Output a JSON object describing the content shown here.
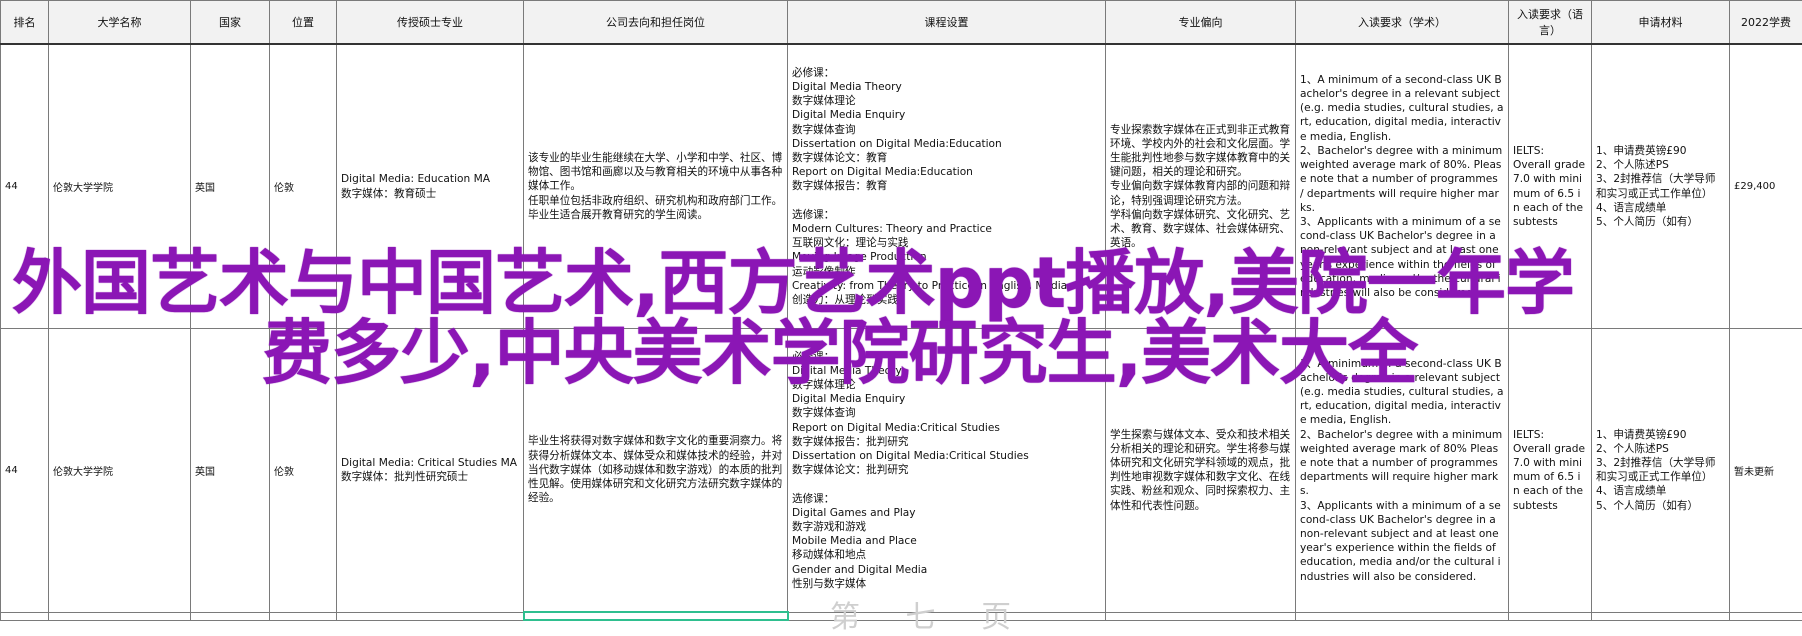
{
  "table": {
    "headers": [
      "排名",
      "大学名称",
      "国家",
      "位置",
      "传授硕士专业",
      "公司去向和担任岗位",
      "课程设置",
      "专业偏向",
      "入读要求（学术）",
      "入读要求（语言）",
      "申请材料",
      "2022学费"
    ],
    "rows": [
      {
        "rank": "44",
        "university": "伦敦大学学院",
        "country": "英国",
        "location": "伦敦",
        "program": "Digital Media: Education MA\n数字媒体：教育硕士",
        "careers": "该专业的毕业生能继续在大学、小学和中学、社区、博物馆、图书馆和画廊以及与教育相关的环境中从事各种媒体工作。\n任职单位包括非政府组织、研究机构和政府部门工作。毕业生适合展开教育研究的学生阅读。",
        "courses": "必修课：\nDigital Media Theory\n数字媒体理论\nDigital Media Enquiry\n数字媒体查询\nDissertation on Digital Media:Education\n数字媒体论文：教育\nReport on Digital Media:Education\n数字媒体报告：教育\n\n选修课：\nModern Cultures: Theory and Practice\n互联网文化：理论与实践\nMoving Image Production\n运动影像制作\nCreativity: from Theory to Practice in English, Media\n创造力：从理论到实践",
        "focus": "专业探索数字媒体在正式到非正式教育环境、学校内外的社会和文化层面。学生能批判性地参与数字媒体教育中的关键问题，相关的理论和研究。\n专业偏向数字媒体教育内部的问题和辩论，特别强调理论研究方法。\n学科偏向数字媒体研究、文化研究、艺术、教育、数字媒体、社会媒体研究、英语。",
        "academic": "1、A minimum of a second-class UK Bachelor's degree in a relevant subject (e.g. media studies, cultural studies, art, education, digital media, interactive media, English.\n2、Bachelor's degree with a minimum weighted average mark of 80%. Please note that a number of programmes / departments will require higher marks.\n3、Applicants with a minimum of a second-class UK Bachelor's degree in a non-relevant subject and at least one year's experience within the fields of education, media and/or the cultural industries will also be considered.",
        "language": "IELTS:\nOverall grade 7.0 with minimum of 6.5 in each of the subtests",
        "materials": "1、申请费英镑£90\n2、个人陈述PS\n3、2封推荐信（大学导师和实习或正式工作单位）\n4、语言成绩单\n5、个人简历（如有）",
        "fee": "£29,400"
      },
      {
        "rank": "44",
        "university": "伦敦大学学院",
        "country": "英国",
        "location": "伦敦",
        "program": "Digital Media: Critical Studies MA\n数字媒体：批判性研究硕士",
        "careers": "毕业生将获得对数字媒体和数字文化的重要洞察力。将获得分析媒体文本、媒体受众和媒体技术的经验，并对当代数字媒体（如移动媒体和数字游戏）的本质的批判性见解。使用媒体研究和文化研究方法研究数字媒体的经验。",
        "courses": "必修课：\nDigital Media Theory\n数字媒体理论\nDigital Media Enquiry\n数字媒体查询\nReport on Digital Media:Critical Studies\n数字媒体报告：批判研究\nDissertation on Digital Media:Critical Studies\n数字媒体论文：批判研究\n\n选修课：\nDigital Games and Play\n数字游戏和游戏\nMobile Media and Place\n移动媒体和地点\nGender and Digital Media\n性别与数字媒体",
        "focus": "学生探索与媒体文本、受众和技术相关分析相关的理论和研究。学生将参与媒体研究和文化研究学科领域的观点，批判性地审视数字媒体和数字文化、在线实践、粉丝和观众、同时探索权力、主体性和代表性问题。",
        "academic": "1、A minimum of a second-class UK Bachelor's degree in a relevant subject (e.g. media studies, cultural studies, art, education, digital media, interactive media, English.\n2、Bachelor's degree with a minimum weighted average mark of 80% Please note that a number of programmes departments will require higher marks.\n3、Applicants with a minimum of a second-class UK Bachelor's degree in a non-relevant subject and at least one year's experience within the fields of education, media and/or the cultural industries will also be considered.",
        "language": "IELTS:\nOverall grade 7.0 with minimum of 6.5 in each of the subtests",
        "materials": "1、申请费英镑£90\n2、个人陈述PS\n3、2封推荐信（大学导师和实习或正式工作单位）\n4、语言成绩单\n5、个人简历（如有）",
        "fee": "暂未更新"
      }
    ]
  },
  "overlay": {
    "line1": "外国艺术与中国艺术,西方艺术ppt播放,美院一年学",
    "line2": "费多少,中央美术学院研究生,美术大全",
    "ghost_text": "第 七 页"
  }
}
